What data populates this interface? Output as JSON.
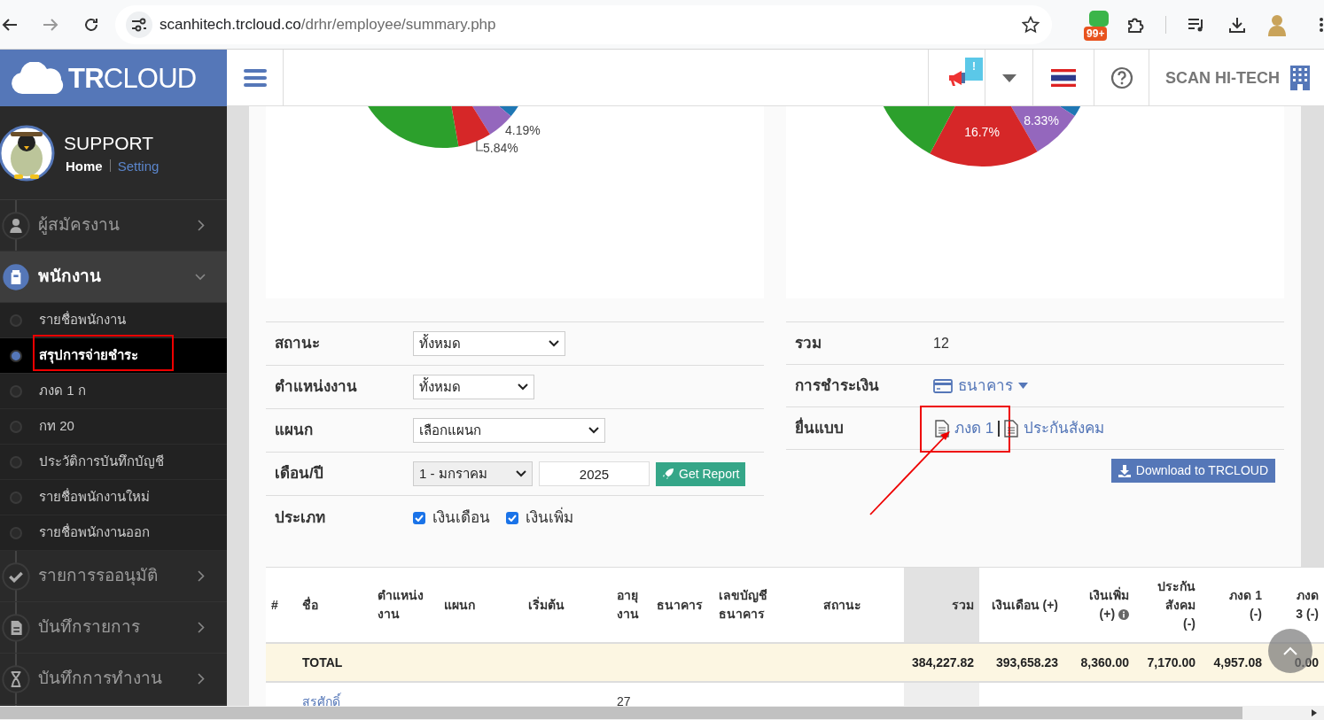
{
  "browser": {
    "url_domain": "scanhitech.trcloud.co",
    "url_path": "/drhr/employee/summary.php",
    "extension_badge": "99+"
  },
  "header": {
    "logo": "**TR**CLOUD",
    "notification_badge": "!",
    "company": "SCAN HI-TECH"
  },
  "sidebar": {
    "user": {
      "name": "SUPPORT",
      "links": [
        {
          "label": "Home",
          "selected": true
        },
        {
          "label": "Setting",
          "selected": false
        }
      ]
    },
    "menu": [
      {
        "label": "ผู้สมัครงาน",
        "kind": "user",
        "expanded": false
      },
      {
        "label": "พนักงาน",
        "kind": "employee",
        "expanded": true,
        "children": [
          {
            "label": "รายชื่อพนักงาน",
            "selected": false,
            "annotated": false
          },
          {
            "label": "สรุปการจ่ายชำระ",
            "selected": true,
            "annotated": true
          },
          {
            "label": "ภงด 1 ก",
            "selected": false,
            "annotated": false
          },
          {
            "label": "กท 20",
            "selected": false,
            "annotated": false
          },
          {
            "label": "ประวัติการบันทึกบัญชี",
            "selected": false,
            "annotated": false
          },
          {
            "label": "รายชื่อพนักงานใหม่",
            "selected": false,
            "annotated": false
          },
          {
            "label": "รายชื่อพนักงานออก",
            "selected": false,
            "annotated": false
          }
        ]
      },
      {
        "label": "รายการรออนุมัติ",
        "kind": "check",
        "expanded": false
      },
      {
        "label": "บันทึกรายการ",
        "kind": "document",
        "expanded": false
      },
      {
        "label": "บันทึกการทำงาน",
        "kind": "hourglass",
        "expanded": false
      }
    ]
  },
  "charts": [
    {
      "labels": [
        "4.19%",
        "5.84%"
      ]
    },
    {
      "labels": [
        "16.7%",
        "8.33%"
      ]
    }
  ],
  "filters": [
    {
      "label": "สถานะ",
      "kind": "select",
      "value": "ทั้งหมด"
    },
    {
      "label": "ตำแหน่งงาน",
      "kind": "select",
      "value": "ทั้งหมด"
    },
    {
      "label": "แผนก",
      "kind": "select",
      "value": "เลือกแผนก"
    },
    {
      "label": "เดือน/ปี",
      "kind": "month_year",
      "month": "1 - มกราคม",
      "year": "2025",
      "button": "Get Report"
    },
    {
      "label": "ประเภท",
      "kind": "checkboxes",
      "options": [
        {
          "label": "เงินเดือน",
          "checked": true
        },
        {
          "label": "เงินเพิ่ม",
          "checked": true
        }
      ]
    }
  ],
  "summary": [
    {
      "label": "รวม",
      "kind": "text",
      "value": "12"
    },
    {
      "label": "การชำระเงิน",
      "kind": "dropdown",
      "value": "ธนาคาร"
    },
    {
      "label": "ยื่นแบบ",
      "kind": "links",
      "links": [
        {
          "label": "ภงด 1",
          "annotated": true
        },
        {
          "label": "ประกันสังคม",
          "annotated": false
        }
      ]
    }
  ],
  "download_button": "Download to TRCLOUD",
  "table": {
    "columns": [
      {
        "lines": [
          "#"
        ],
        "kind": "text",
        "shaded": false
      },
      {
        "lines": [
          "ชื่อ"
        ],
        "kind": "text",
        "shaded": false
      },
      {
        "lines": [
          "ตำแหน่ง",
          "งาน"
        ],
        "kind": "text",
        "shaded": false
      },
      {
        "lines": [
          "แผนก"
        ],
        "kind": "text",
        "shaded": false
      },
      {
        "lines": [
          "เริ่มต้น"
        ],
        "kind": "text",
        "shaded": false
      },
      {
        "lines": [
          "อายุ",
          "งาน"
        ],
        "kind": "text",
        "shaded": false
      },
      {
        "lines": [
          "ธนาคาร"
        ],
        "kind": "text",
        "shaded": false
      },
      {
        "lines": [
          "เลขบัญชี",
          "ธนาคาร"
        ],
        "kind": "text",
        "shaded": false
      },
      {
        "lines": [
          "สถานะ"
        ],
        "kind": "center",
        "shaded": false
      },
      {
        "lines": [
          "รวม"
        ],
        "kind": "number",
        "shaded": true
      },
      {
        "lines": [
          "เงินเดือน (+)"
        ],
        "kind": "number",
        "shaded": false
      },
      {
        "lines": [
          "เงินเพิ่ม",
          "(+)"
        ],
        "kind": "number",
        "shaded": false,
        "info": true
      },
      {
        "lines": [
          "ประกัน",
          "สังคม",
          "(-)"
        ],
        "kind": "number",
        "shaded": false
      },
      {
        "lines": [
          "ภงด 1",
          "(-)"
        ],
        "kind": "number",
        "shaded": false
      },
      {
        "lines": [
          "ภงด",
          "3 (-)"
        ],
        "kind": "number",
        "shaded": false
      }
    ],
    "total_row": {
      "label": "TOTAL",
      "values": [
        "384,227.82",
        "393,658.23",
        "8,360.00",
        "7,170.00",
        "4,957.08",
        "0.00"
      ]
    },
    "rows": [
      {
        "name": "สรศักดิ์",
        "service_years": "27"
      }
    ]
  }
}
